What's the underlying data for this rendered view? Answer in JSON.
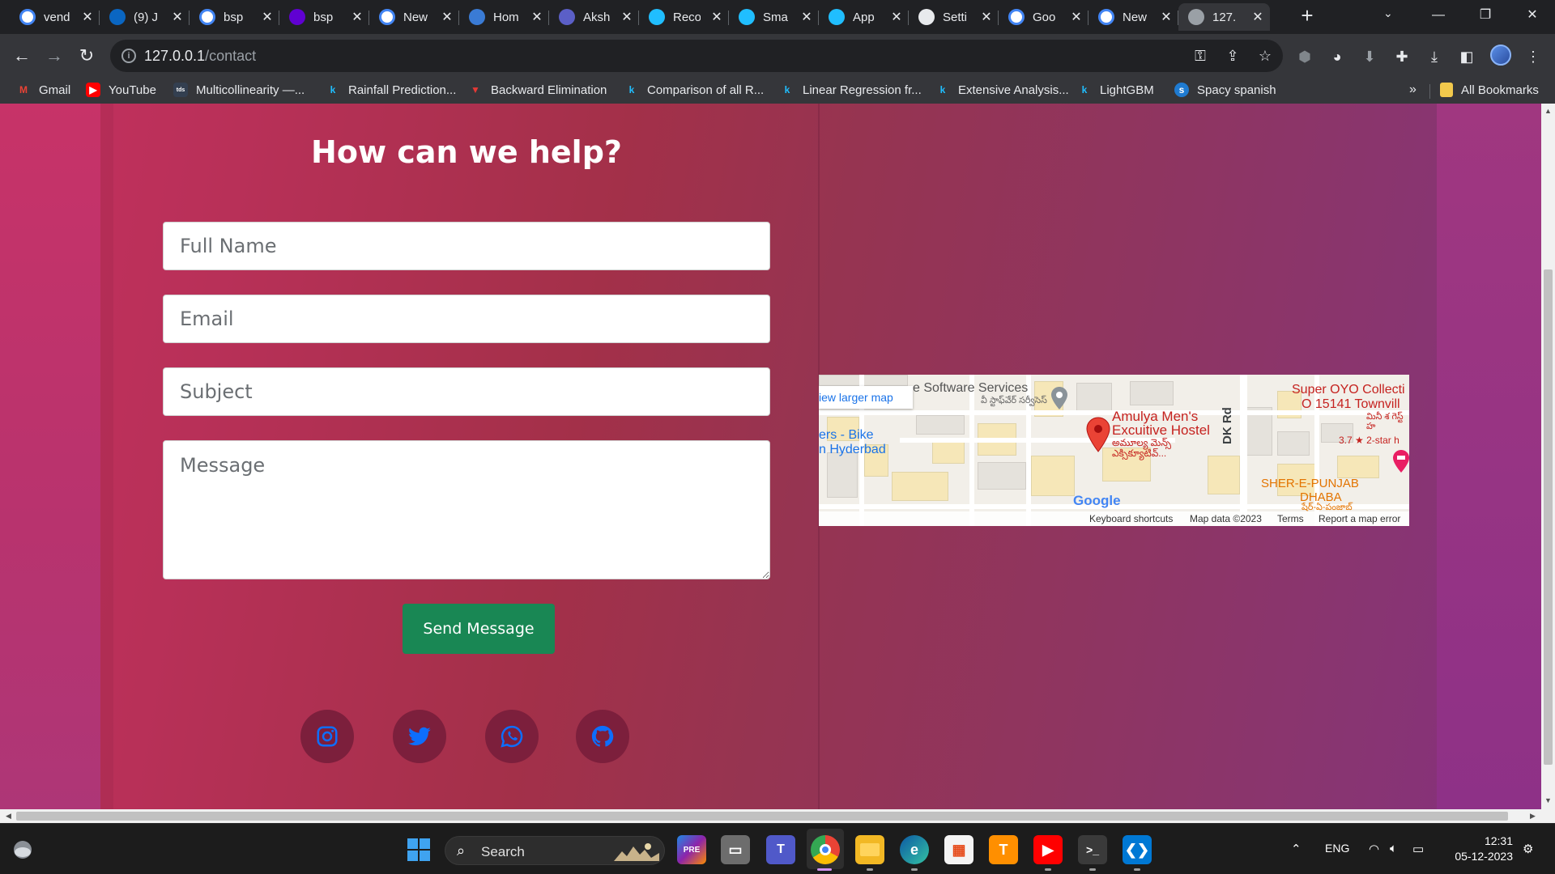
{
  "browser": {
    "tabs": [
      {
        "title": "vend",
        "icon": "google-icon",
        "color": "#ffffff"
      },
      {
        "title": "(9) J",
        "icon": "linkedin-icon",
        "color": "#0a66c2"
      },
      {
        "title": "bsp",
        "icon": "google-icon",
        "color": "#ffffff"
      },
      {
        "title": "bsp",
        "icon": "yahoo-icon",
        "color": "#6001d2"
      },
      {
        "title": "New",
        "icon": "chrome-icon",
        "color": "#ffffff"
      },
      {
        "title": "Hom",
        "icon": "codeium-icon",
        "color": "#3a7bd5"
      },
      {
        "title": "Aksh",
        "icon": "app-icon",
        "color": "#5b5fc7"
      },
      {
        "title": "Reco",
        "icon": "kaggle-icon",
        "color": "#20beff"
      },
      {
        "title": "Sma",
        "icon": "kaggle-icon",
        "color": "#20beff"
      },
      {
        "title": "App",
        "icon": "kaggle-icon",
        "color": "#20beff"
      },
      {
        "title": "Setti",
        "icon": "gear-icon",
        "color": "#e8eaed"
      },
      {
        "title": "Goo",
        "icon": "google-lens-icon",
        "color": "#ffffff"
      },
      {
        "title": "New",
        "icon": "chrome-icon",
        "color": "#ffffff"
      },
      {
        "title": "127.",
        "icon": "globe-icon",
        "color": "#9aa0a6",
        "active": true
      }
    ],
    "address": {
      "host": "127.0.0.1",
      "path": "/contact"
    },
    "bookmarks": [
      {
        "label": "Gmail",
        "icon": "gmail-icon",
        "color": "#ea4335"
      },
      {
        "label": "YouTube",
        "icon": "youtube-icon",
        "color": "#ff0000"
      },
      {
        "label": "Multicollinearity —...",
        "icon": "tds-icon",
        "color": "#333f50"
      },
      {
        "label": "Rainfall Prediction...",
        "icon": "kaggle-icon",
        "color": "#20beff"
      },
      {
        "label": "Backward Elimination",
        "icon": "triangle-icon",
        "color": "#e53935"
      },
      {
        "label": "Comparison of all R...",
        "icon": "kaggle-icon",
        "color": "#20beff"
      },
      {
        "label": "Linear Regression fr...",
        "icon": "kaggle-icon",
        "color": "#20beff"
      },
      {
        "label": "Extensive Analysis...",
        "icon": "kaggle-icon",
        "color": "#20beff"
      },
      {
        "label": "LightGBM",
        "icon": "kaggle-icon",
        "color": "#20beff"
      },
      {
        "label": "Spacy spanish",
        "icon": "spacy-icon",
        "color": "#1f7bd1"
      }
    ],
    "more_bookmarks": "»",
    "all_bookmarks": "All Bookmarks"
  },
  "page": {
    "heading": "How can we help?",
    "form": {
      "name_placeholder": "Full Name",
      "email_placeholder": "Email",
      "subject_placeholder": "Subject",
      "message_placeholder": "Message",
      "send_label": "Send Message"
    },
    "social": [
      "instagram-icon",
      "twitter-icon",
      "whatsapp-icon",
      "github-icon"
    ],
    "colors": {
      "send_button": "#198754",
      "social_icon": "#0d6efd",
      "social_bg": "#7c1f3c"
    },
    "map": {
      "view_larger": "iew larger map",
      "place_software": "e Software Services",
      "place_software_te": "వీ‌ స్టాఫ్‌వేర్ సర్వీసెస్",
      "place_hostel_1": "Amulya Men's",
      "place_hostel_2": "Excuitive Hostel",
      "place_hostel_te": "అమూల్య మెన్స్ ఎక్సిక్యూటివ్...",
      "place_bike_1": "ers - Bike",
      "place_bike_2": "n Hyderbad",
      "road": "DK Rd",
      "place_oyo_1": "Super OYO Collecti",
      "place_oyo_2": "O 15141 Townvill",
      "place_oyo_te": "మినీ శ గెస్ట్ హ",
      "rating": "3.7 ★ 2-star h",
      "place_dhaba_1": "SHER-E-PUNJAB",
      "place_dhaba_2": "DHABA",
      "place_dhaba_te": "షేర్-ఏ-పంజాబ్",
      "logo": "Google",
      "footer": {
        "shortcuts": "Keyboard shortcuts",
        "data": "Map data ©2023",
        "terms": "Terms",
        "report": "Report a map error"
      }
    }
  },
  "taskbar": {
    "search": "Search",
    "lang": "ENG",
    "time": "12:31",
    "date": "05-12-2023"
  }
}
